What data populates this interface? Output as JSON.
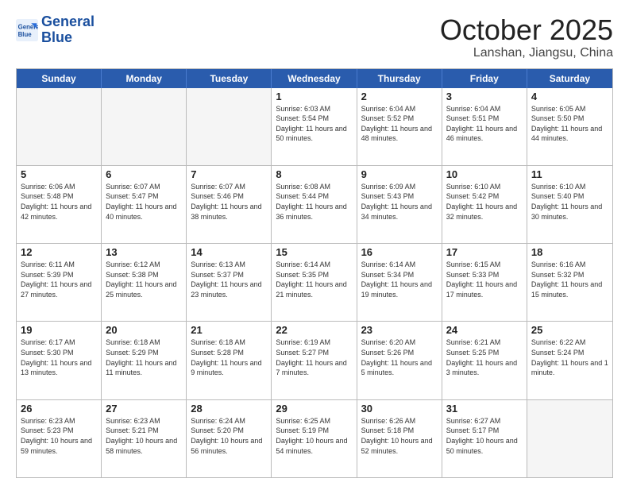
{
  "header": {
    "logo_line1": "General",
    "logo_line2": "Blue",
    "month": "October 2025",
    "location": "Lanshan, Jiangsu, China"
  },
  "days_of_week": [
    "Sunday",
    "Monday",
    "Tuesday",
    "Wednesday",
    "Thursday",
    "Friday",
    "Saturday"
  ],
  "weeks": [
    [
      {
        "day": "",
        "sunrise": "",
        "sunset": "",
        "daylight": ""
      },
      {
        "day": "",
        "sunrise": "",
        "sunset": "",
        "daylight": ""
      },
      {
        "day": "",
        "sunrise": "",
        "sunset": "",
        "daylight": ""
      },
      {
        "day": "1",
        "sunrise": "Sunrise: 6:03 AM",
        "sunset": "Sunset: 5:54 PM",
        "daylight": "Daylight: 11 hours and 50 minutes."
      },
      {
        "day": "2",
        "sunrise": "Sunrise: 6:04 AM",
        "sunset": "Sunset: 5:52 PM",
        "daylight": "Daylight: 11 hours and 48 minutes."
      },
      {
        "day": "3",
        "sunrise": "Sunrise: 6:04 AM",
        "sunset": "Sunset: 5:51 PM",
        "daylight": "Daylight: 11 hours and 46 minutes."
      },
      {
        "day": "4",
        "sunrise": "Sunrise: 6:05 AM",
        "sunset": "Sunset: 5:50 PM",
        "daylight": "Daylight: 11 hours and 44 minutes."
      }
    ],
    [
      {
        "day": "5",
        "sunrise": "Sunrise: 6:06 AM",
        "sunset": "Sunset: 5:48 PM",
        "daylight": "Daylight: 11 hours and 42 minutes."
      },
      {
        "day": "6",
        "sunrise": "Sunrise: 6:07 AM",
        "sunset": "Sunset: 5:47 PM",
        "daylight": "Daylight: 11 hours and 40 minutes."
      },
      {
        "day": "7",
        "sunrise": "Sunrise: 6:07 AM",
        "sunset": "Sunset: 5:46 PM",
        "daylight": "Daylight: 11 hours and 38 minutes."
      },
      {
        "day": "8",
        "sunrise": "Sunrise: 6:08 AM",
        "sunset": "Sunset: 5:44 PM",
        "daylight": "Daylight: 11 hours and 36 minutes."
      },
      {
        "day": "9",
        "sunrise": "Sunrise: 6:09 AM",
        "sunset": "Sunset: 5:43 PM",
        "daylight": "Daylight: 11 hours and 34 minutes."
      },
      {
        "day": "10",
        "sunrise": "Sunrise: 6:10 AM",
        "sunset": "Sunset: 5:42 PM",
        "daylight": "Daylight: 11 hours and 32 minutes."
      },
      {
        "day": "11",
        "sunrise": "Sunrise: 6:10 AM",
        "sunset": "Sunset: 5:40 PM",
        "daylight": "Daylight: 11 hours and 30 minutes."
      }
    ],
    [
      {
        "day": "12",
        "sunrise": "Sunrise: 6:11 AM",
        "sunset": "Sunset: 5:39 PM",
        "daylight": "Daylight: 11 hours and 27 minutes."
      },
      {
        "day": "13",
        "sunrise": "Sunrise: 6:12 AM",
        "sunset": "Sunset: 5:38 PM",
        "daylight": "Daylight: 11 hours and 25 minutes."
      },
      {
        "day": "14",
        "sunrise": "Sunrise: 6:13 AM",
        "sunset": "Sunset: 5:37 PM",
        "daylight": "Daylight: 11 hours and 23 minutes."
      },
      {
        "day": "15",
        "sunrise": "Sunrise: 6:14 AM",
        "sunset": "Sunset: 5:35 PM",
        "daylight": "Daylight: 11 hours and 21 minutes."
      },
      {
        "day": "16",
        "sunrise": "Sunrise: 6:14 AM",
        "sunset": "Sunset: 5:34 PM",
        "daylight": "Daylight: 11 hours and 19 minutes."
      },
      {
        "day": "17",
        "sunrise": "Sunrise: 6:15 AM",
        "sunset": "Sunset: 5:33 PM",
        "daylight": "Daylight: 11 hours and 17 minutes."
      },
      {
        "day": "18",
        "sunrise": "Sunrise: 6:16 AM",
        "sunset": "Sunset: 5:32 PM",
        "daylight": "Daylight: 11 hours and 15 minutes."
      }
    ],
    [
      {
        "day": "19",
        "sunrise": "Sunrise: 6:17 AM",
        "sunset": "Sunset: 5:30 PM",
        "daylight": "Daylight: 11 hours and 13 minutes."
      },
      {
        "day": "20",
        "sunrise": "Sunrise: 6:18 AM",
        "sunset": "Sunset: 5:29 PM",
        "daylight": "Daylight: 11 hours and 11 minutes."
      },
      {
        "day": "21",
        "sunrise": "Sunrise: 6:18 AM",
        "sunset": "Sunset: 5:28 PM",
        "daylight": "Daylight: 11 hours and 9 minutes."
      },
      {
        "day": "22",
        "sunrise": "Sunrise: 6:19 AM",
        "sunset": "Sunset: 5:27 PM",
        "daylight": "Daylight: 11 hours and 7 minutes."
      },
      {
        "day": "23",
        "sunrise": "Sunrise: 6:20 AM",
        "sunset": "Sunset: 5:26 PM",
        "daylight": "Daylight: 11 hours and 5 minutes."
      },
      {
        "day": "24",
        "sunrise": "Sunrise: 6:21 AM",
        "sunset": "Sunset: 5:25 PM",
        "daylight": "Daylight: 11 hours and 3 minutes."
      },
      {
        "day": "25",
        "sunrise": "Sunrise: 6:22 AM",
        "sunset": "Sunset: 5:24 PM",
        "daylight": "Daylight: 11 hours and 1 minute."
      }
    ],
    [
      {
        "day": "26",
        "sunrise": "Sunrise: 6:23 AM",
        "sunset": "Sunset: 5:23 PM",
        "daylight": "Daylight: 10 hours and 59 minutes."
      },
      {
        "day": "27",
        "sunrise": "Sunrise: 6:23 AM",
        "sunset": "Sunset: 5:21 PM",
        "daylight": "Daylight: 10 hours and 58 minutes."
      },
      {
        "day": "28",
        "sunrise": "Sunrise: 6:24 AM",
        "sunset": "Sunset: 5:20 PM",
        "daylight": "Daylight: 10 hours and 56 minutes."
      },
      {
        "day": "29",
        "sunrise": "Sunrise: 6:25 AM",
        "sunset": "Sunset: 5:19 PM",
        "daylight": "Daylight: 10 hours and 54 minutes."
      },
      {
        "day": "30",
        "sunrise": "Sunrise: 6:26 AM",
        "sunset": "Sunset: 5:18 PM",
        "daylight": "Daylight: 10 hours and 52 minutes."
      },
      {
        "day": "31",
        "sunrise": "Sunrise: 6:27 AM",
        "sunset": "Sunset: 5:17 PM",
        "daylight": "Daylight: 10 hours and 50 minutes."
      },
      {
        "day": "",
        "sunrise": "",
        "sunset": "",
        "daylight": ""
      }
    ]
  ]
}
